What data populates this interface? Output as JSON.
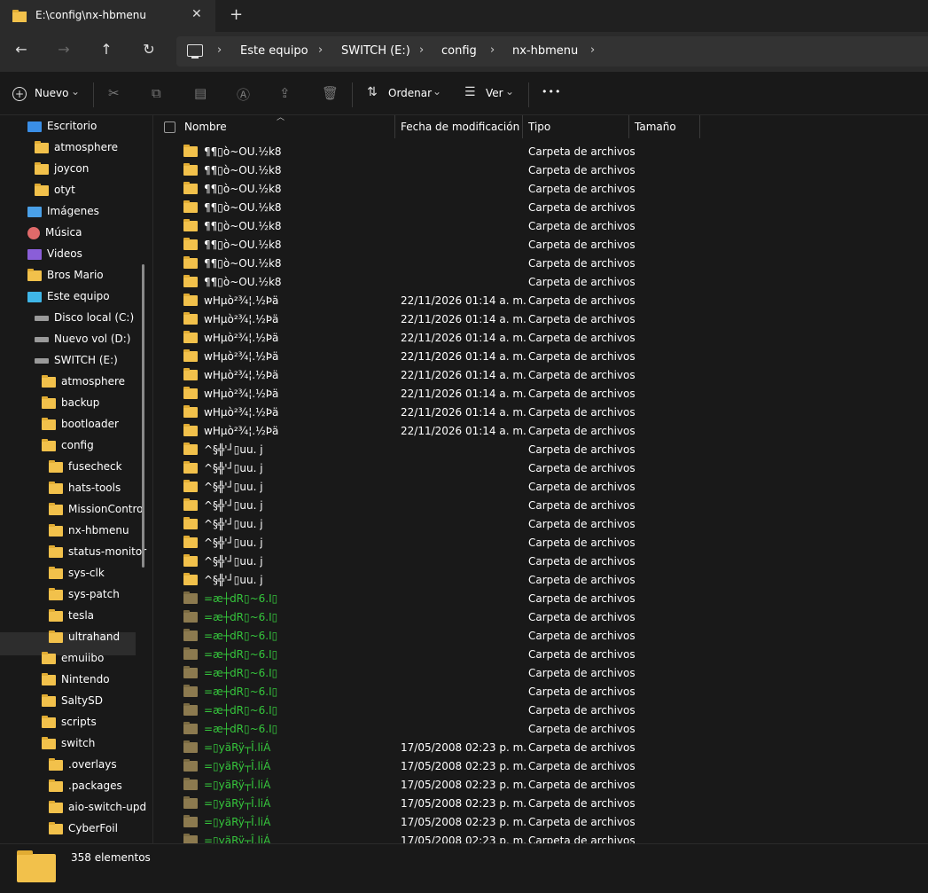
{
  "tab": {
    "title": "E:\\config\\nx-hbmenu",
    "close": "✕",
    "add": "+"
  },
  "nav": {
    "back": "←",
    "forward": "→",
    "up": "↑",
    "refresh": "↻"
  },
  "breadcrumb": {
    "items": [
      "Este equipo",
      "SWITCH (E:)",
      "config",
      "nx-hbmenu"
    ],
    "separator": "›"
  },
  "toolbar": {
    "new_label": "Nuevo",
    "sort_label": "Ordenar",
    "view_label": "Ver",
    "more": "•••",
    "dropdown": "⌄"
  },
  "columns": {
    "name": "Nombre",
    "date": "Fecha de modificación",
    "type": "Tipo",
    "size": "Tamaño"
  },
  "sidebar": {
    "items": [
      {
        "label": "Escritorio",
        "icon": "desktop-icon",
        "indent": 0
      },
      {
        "label": "atmosphere",
        "icon": "folder-icon",
        "indent": 1
      },
      {
        "label": "joycon",
        "icon": "folder-icon",
        "indent": 1
      },
      {
        "label": "otyt",
        "icon": "folder-icon",
        "indent": 1
      },
      {
        "label": "Imágenes",
        "icon": "pictures-icon",
        "indent": 0
      },
      {
        "label": "Música",
        "icon": "music-icon",
        "indent": 0
      },
      {
        "label": "Videos",
        "icon": "videos-icon",
        "indent": 0
      },
      {
        "label": "Bros Mario",
        "icon": "folder-icon",
        "indent": 0
      },
      {
        "label": "Este equipo",
        "icon": "pc-icon",
        "indent": 0
      },
      {
        "label": "Disco local (C:)",
        "icon": "drive-icon",
        "indent": 1
      },
      {
        "label": "Nuevo vol (D:)",
        "icon": "drive-icon",
        "indent": 1
      },
      {
        "label": "SWITCH (E:)",
        "icon": "drive-icon",
        "indent": 1
      },
      {
        "label": "atmosphere",
        "icon": "folder-icon",
        "indent": 2
      },
      {
        "label": "backup",
        "icon": "folder-icon",
        "indent": 2
      },
      {
        "label": "bootloader",
        "icon": "folder-icon",
        "indent": 2
      },
      {
        "label": "config",
        "icon": "folder-icon",
        "indent": 2
      },
      {
        "label": "fusecheck",
        "icon": "folder-icon",
        "indent": 3
      },
      {
        "label": "hats-tools",
        "icon": "folder-icon",
        "indent": 3
      },
      {
        "label": "MissionContro",
        "icon": "folder-icon",
        "indent": 3
      },
      {
        "label": "nx-hbmenu",
        "icon": "folder-icon",
        "indent": 3
      },
      {
        "label": "status-monitor",
        "icon": "folder-icon",
        "indent": 3
      },
      {
        "label": "sys-clk",
        "icon": "folder-icon",
        "indent": 3
      },
      {
        "label": "sys-patch",
        "icon": "folder-icon",
        "indent": 3
      },
      {
        "label": "tesla",
        "icon": "folder-icon",
        "indent": 3
      },
      {
        "label": "ultrahand",
        "icon": "folder-icon",
        "indent": 3
      },
      {
        "label": "emuiibo",
        "icon": "folder-icon",
        "indent": 2
      },
      {
        "label": "Nintendo",
        "icon": "folder-icon",
        "indent": 2
      },
      {
        "label": "SaltySD",
        "icon": "folder-icon",
        "indent": 2
      },
      {
        "label": "scripts",
        "icon": "folder-icon",
        "indent": 2
      },
      {
        "label": "switch",
        "icon": "folder-icon",
        "indent": 2
      },
      {
        "label": ".overlays",
        "icon": "folder-icon",
        "indent": 3
      },
      {
        "label": ".packages",
        "icon": "folder-icon",
        "indent": 3
      },
      {
        "label": "aio-switch-upd",
        "icon": "folder-icon",
        "indent": 3
      },
      {
        "label": "CyberFoil",
        "icon": "folder-icon",
        "indent": 3
      }
    ]
  },
  "files": [
    {
      "name": "¶¶▯ò~OU.½k8",
      "date": "",
      "type": "Carpeta de archivos",
      "hidden": false
    },
    {
      "name": "¶¶▯ò~OU.½k8",
      "date": "",
      "type": "Carpeta de archivos",
      "hidden": false
    },
    {
      "name": "¶¶▯ò~OU.½k8",
      "date": "",
      "type": "Carpeta de archivos",
      "hidden": false
    },
    {
      "name": "¶¶▯ò~OU.½k8",
      "date": "",
      "type": "Carpeta de archivos",
      "hidden": false
    },
    {
      "name": "¶¶▯ò~OU.½k8",
      "date": "",
      "type": "Carpeta de archivos",
      "hidden": false
    },
    {
      "name": "¶¶▯ò~OU.½k8",
      "date": "",
      "type": "Carpeta de archivos",
      "hidden": false
    },
    {
      "name": "¶¶▯ò~OU.½k8",
      "date": "",
      "type": "Carpeta de archivos",
      "hidden": false
    },
    {
      "name": "¶¶▯ò~OU.½k8",
      "date": "",
      "type": "Carpeta de archivos",
      "hidden": false
    },
    {
      "name": "wHµò²¾¦.½Þä",
      "date": "22/11/2026 01:14 a. m.",
      "type": "Carpeta de archivos",
      "hidden": false
    },
    {
      "name": "wHµò²¾¦.½Þä",
      "date": "22/11/2026 01:14 a. m.",
      "type": "Carpeta de archivos",
      "hidden": false
    },
    {
      "name": "wHµò²¾¦.½Þä",
      "date": "22/11/2026 01:14 a. m.",
      "type": "Carpeta de archivos",
      "hidden": false
    },
    {
      "name": "wHµò²¾¦.½Þä",
      "date": "22/11/2026 01:14 a. m.",
      "type": "Carpeta de archivos",
      "hidden": false
    },
    {
      "name": "wHµò²¾¦.½Þä",
      "date": "22/11/2026 01:14 a. m.",
      "type": "Carpeta de archivos",
      "hidden": false
    },
    {
      "name": "wHµò²¾¦.½Þä",
      "date": "22/11/2026 01:14 a. m.",
      "type": "Carpeta de archivos",
      "hidden": false
    },
    {
      "name": "wHµò²¾¦.½Þä",
      "date": "22/11/2026 01:14 a. m.",
      "type": "Carpeta de archivos",
      "hidden": false
    },
    {
      "name": "wHµò²¾¦.½Þä",
      "date": "22/11/2026 01:14 a. m.",
      "type": "Carpeta de archivos",
      "hidden": false
    },
    {
      "name": "^§╬'┘▯uu. j",
      "date": "",
      "type": "Carpeta de archivos",
      "hidden": false
    },
    {
      "name": "^§╬'┘▯uu. j",
      "date": "",
      "type": "Carpeta de archivos",
      "hidden": false
    },
    {
      "name": "^§╬'┘▯uu. j",
      "date": "",
      "type": "Carpeta de archivos",
      "hidden": false
    },
    {
      "name": "^§╬'┘▯uu. j",
      "date": "",
      "type": "Carpeta de archivos",
      "hidden": false
    },
    {
      "name": "^§╬'┘▯uu. j",
      "date": "",
      "type": "Carpeta de archivos",
      "hidden": false
    },
    {
      "name": "^§╬'┘▯uu. j",
      "date": "",
      "type": "Carpeta de archivos",
      "hidden": false
    },
    {
      "name": "^§╬'┘▯uu. j",
      "date": "",
      "type": "Carpeta de archivos",
      "hidden": false
    },
    {
      "name": "^§╬'┘▯uu. j",
      "date": "",
      "type": "Carpeta de archivos",
      "hidden": false
    },
    {
      "name": "=æ┼dR▯~6.I▯",
      "date": "",
      "type": "Carpeta de archivos",
      "hidden": true
    },
    {
      "name": "=æ┼dR▯~6.I▯",
      "date": "",
      "type": "Carpeta de archivos",
      "hidden": true
    },
    {
      "name": "=æ┼dR▯~6.I▯",
      "date": "",
      "type": "Carpeta de archivos",
      "hidden": true
    },
    {
      "name": "=æ┼dR▯~6.I▯",
      "date": "",
      "type": "Carpeta de archivos",
      "hidden": true
    },
    {
      "name": "=æ┼dR▯~6.I▯",
      "date": "",
      "type": "Carpeta de archivos",
      "hidden": true
    },
    {
      "name": "=æ┼dR▯~6.I▯",
      "date": "",
      "type": "Carpeta de archivos",
      "hidden": true
    },
    {
      "name": "=æ┼dR▯~6.I▯",
      "date": "",
      "type": "Carpeta de archivos",
      "hidden": true
    },
    {
      "name": "=æ┼dR▯~6.I▯",
      "date": "",
      "type": "Carpeta de archivos",
      "hidden": true
    },
    {
      "name": "=▯yäRÿ┬Î.liÁ",
      "date": "17/05/2008 02:23 p. m.",
      "type": "Carpeta de archivos",
      "hidden": true
    },
    {
      "name": "=▯yäRÿ┬Î.liÁ",
      "date": "17/05/2008 02:23 p. m.",
      "type": "Carpeta de archivos",
      "hidden": true
    },
    {
      "name": "=▯yäRÿ┬Î.liÁ",
      "date": "17/05/2008 02:23 p. m.",
      "type": "Carpeta de archivos",
      "hidden": true
    },
    {
      "name": "=▯yäRÿ┬Î.liÁ",
      "date": "17/05/2008 02:23 p. m.",
      "type": "Carpeta de archivos",
      "hidden": true
    },
    {
      "name": "=▯yäRÿ┬Î.liÁ",
      "date": "17/05/2008 02:23 p. m.",
      "type": "Carpeta de archivos",
      "hidden": true
    },
    {
      "name": "=▯yäRÿ┬Î.liÁ",
      "date": "17/05/2008 02:23 p. m.",
      "type": "Carpeta de archivos",
      "hidden": true
    }
  ],
  "status": {
    "count": "358 elementos"
  },
  "colors": {
    "folder": "#f2c14b",
    "hidden_text": "#35c63c",
    "bg": "#191919"
  }
}
